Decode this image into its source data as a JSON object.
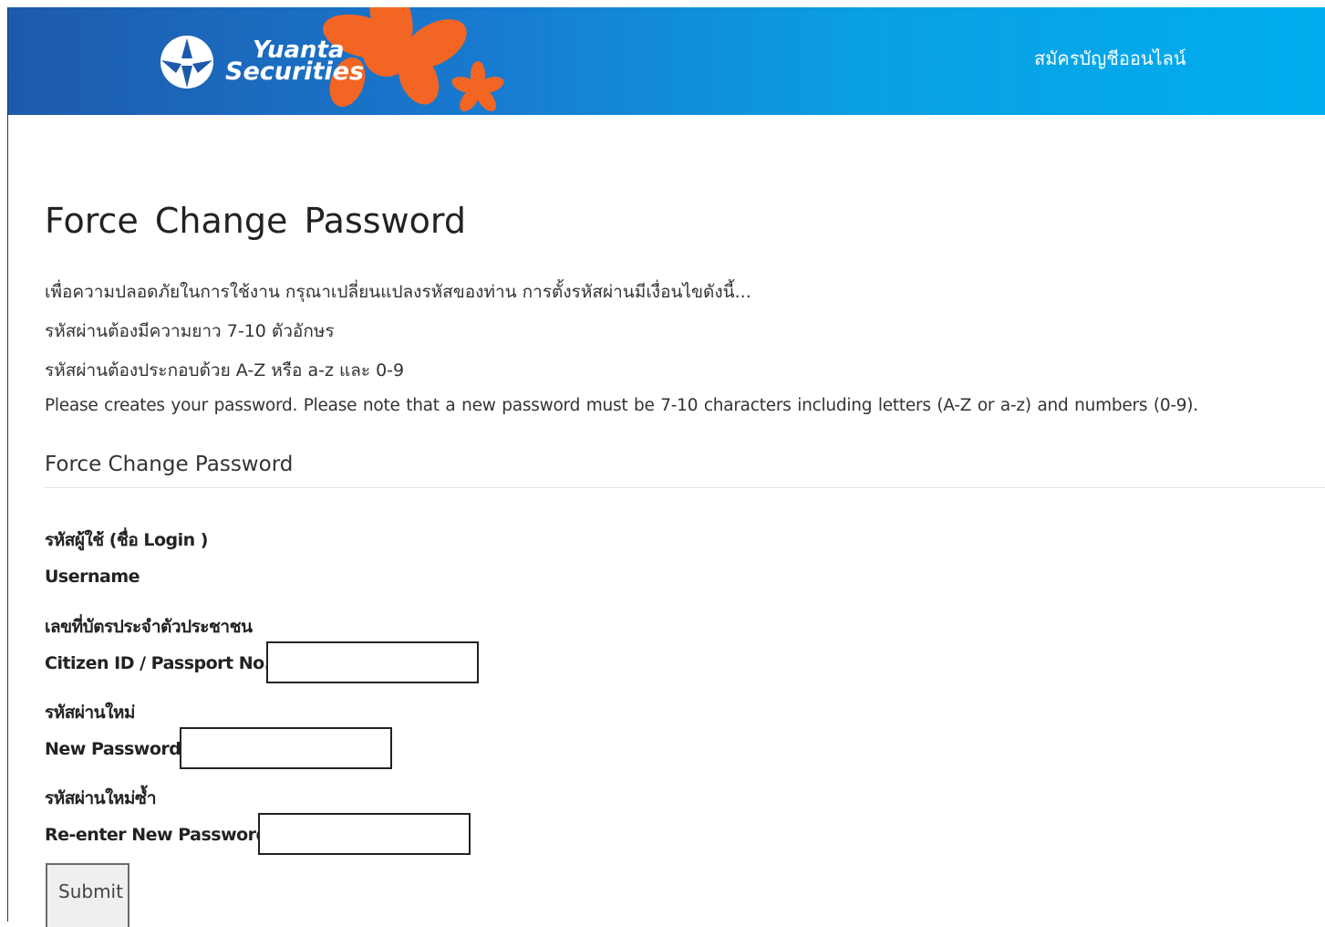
{
  "header": {
    "brand_line1": "Yuanta",
    "brand_line2": "Securities",
    "register_link": "สมัครบัญชีออนไลน์",
    "colors": {
      "gradient_start": "#1e5aab",
      "gradient_end": "#00aeef",
      "flower": "#f26522"
    }
  },
  "main": {
    "title": "Force Change Password",
    "notes": [
      "เพื่อความปลอดภัยในการใช้งาน กรุณาเปลี่ยนแปลงรหัสของท่าน การตั้งรหัสผ่านมีเงื่อนไขดังนี้...",
      "รหัสผ่านต้องมีความยาว 7-10 ตัวอักษร",
      "รหัสผ่านต้องประกอบด้วย A-Z หรือ a-z และ 0-9",
      "Please creates your password. Please note that a new password must be 7-10 characters including letters (A-Z or a-z) and numbers (0-9)."
    ]
  },
  "form": {
    "section_title": "Force Change Password",
    "username_label_th": "รหัสผู้ใช้ (ชื่อ Login )",
    "username_label_en": "Username",
    "citizen_label_th": "เลขที่บัตรประจำตัวประชาชน",
    "citizen_label_en": "Citizen ID / Passport No.",
    "citizen_value": "",
    "new_password_label_th": "รหัสผ่านใหม่",
    "new_password_label_en": "New Password",
    "new_password_value": "",
    "reenter_label_th": "รหัสผ่านใหม่ซ้ำ",
    "reenter_label_en": "Re-enter New Password",
    "reenter_value": "",
    "submit_label": "Submit"
  }
}
